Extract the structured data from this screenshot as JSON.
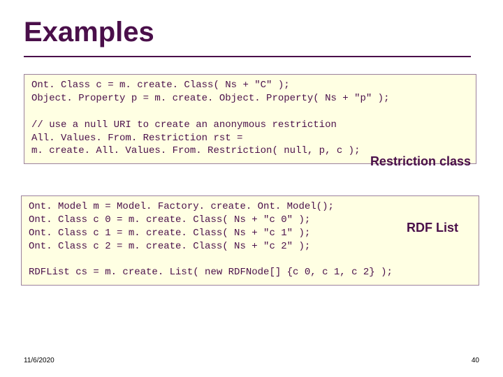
{
  "title": "Examples",
  "box1": {
    "line1": "Ont. Class c = m. create. Class( Ns + \"C\" );",
    "line2": "Object. Property p = m. create. Object. Property( Ns + \"p\" );",
    "blank1": "",
    "line3": "// use a null URI to create an anonymous restriction",
    "line4": "All. Values. From. Restriction rst =",
    "line5": "m. create. All. Values. From. Restriction( null, p, c );"
  },
  "anno1": "Restriction class",
  "box2": {
    "line1": "Ont. Model m = Model. Factory. create. Ont. Model();",
    "line2": "Ont. Class c 0 = m. create. Class( Ns + \"c 0\" );",
    "line3": "Ont. Class c 1 = m. create. Class( Ns + \"c 1\" );",
    "line4": "Ont. Class c 2 = m. create. Class( Ns + \"c 2\" );",
    "blank1": "",
    "line5": "RDFList cs = m. create. List( new RDFNode[] {c 0, c 1, c 2} );"
  },
  "anno2": "RDF List",
  "footer": {
    "date": "11/6/2020",
    "page": "40"
  }
}
